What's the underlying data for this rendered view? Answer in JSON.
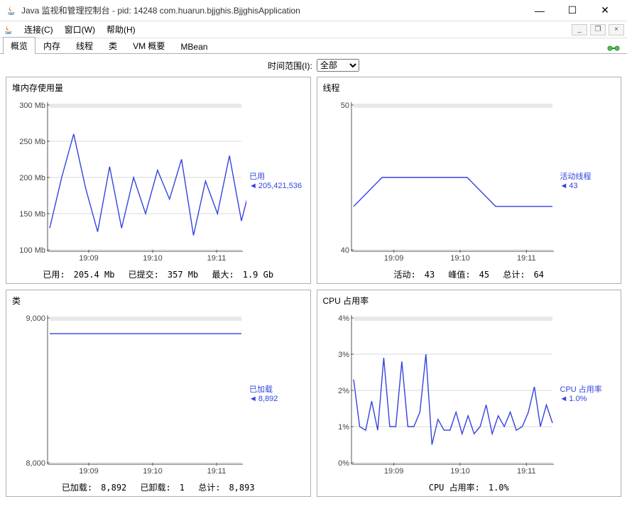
{
  "window": {
    "title": "Java 监视和管理控制台 - pid: 14248 com.huarun.bjjghis.BjjghisApplication"
  },
  "menu": {
    "connect": "连接(C)",
    "window": "窗口(W)",
    "help": "帮助(H)"
  },
  "tabs": [
    "概览",
    "内存",
    "线程",
    "类",
    "VM 概要",
    "MBean"
  ],
  "range": {
    "label": "时间范围(I):",
    "value": "全部"
  },
  "heap": {
    "title": "堆内存使用量",
    "ylabels": [
      "300 Mb",
      "250 Mb",
      "200 Mb",
      "150 Mb",
      "100 Mb"
    ],
    "xlabels": [
      "19:09",
      "19:10",
      "19:11"
    ],
    "legend_title": "已用",
    "legend_value": "205,421,536",
    "stats": {
      "used_l": "已用:",
      "used_v": "205.4  Mb",
      "committed_l": "已提交:",
      "committed_v": "357  Mb",
      "max_l": "最大:",
      "max_v": "1.9  Gb"
    }
  },
  "threads": {
    "title": "线程",
    "ylabels": [
      "50",
      "40"
    ],
    "xlabels": [
      "19:09",
      "19:10",
      "19:11"
    ],
    "legend_title": "活动线程",
    "legend_value": "43",
    "stats": {
      "live_l": "活动:",
      "live_v": "43",
      "peak_l": "峰值:",
      "peak_v": "45",
      "total_l": "总计:",
      "total_v": "64"
    }
  },
  "classes": {
    "title": "类",
    "ylabels": [
      "9,000",
      "8,000"
    ],
    "xlabels": [
      "19:09",
      "19:10",
      "19:11"
    ],
    "legend_title": "已加载",
    "legend_value": "8,892",
    "stats": {
      "loaded_l": "已加载:",
      "loaded_v": "8,892",
      "unloaded_l": "已卸载:",
      "unloaded_v": "1",
      "total_l": "总计:",
      "total_v": "8,893"
    }
  },
  "cpu": {
    "title": "CPU 占用率",
    "ylabels": [
      "4%",
      "3%",
      "2%",
      "1%",
      "0%"
    ],
    "xlabels": [
      "19:09",
      "19:10",
      "19:11"
    ],
    "legend_title": "CPU 占用率",
    "legend_value": "1.0%",
    "stats": {
      "label": "CPU 占用率:",
      "value": "1.0%"
    }
  },
  "chart_data": [
    {
      "type": "line",
      "title": "堆内存使用量",
      "xlabel": "",
      "ylabel": "Mb",
      "ylim": [
        100,
        300
      ],
      "x": [
        "19:08:40",
        "19:08:50",
        "19:09:00",
        "19:09:10",
        "19:09:20",
        "19:09:30",
        "19:09:40",
        "19:09:50",
        "19:10:00",
        "19:10:10",
        "19:10:20",
        "19:10:30",
        "19:10:40",
        "19:10:50",
        "19:11:00",
        "19:11:10",
        "19:11:20"
      ],
      "series": [
        {
          "name": "已用",
          "values": [
            130,
            200,
            260,
            185,
            125,
            215,
            130,
            200,
            150,
            210,
            170,
            225,
            120,
            195,
            150,
            230,
            140,
            205
          ]
        }
      ]
    },
    {
      "type": "line",
      "title": "线程",
      "xlabel": "",
      "ylabel": "",
      "ylim": [
        40,
        50
      ],
      "x": [
        "19:08:40",
        "19:09:00",
        "19:09:30",
        "19:10:00",
        "19:10:15",
        "19:10:30",
        "19:11:00",
        "19:11:25"
      ],
      "series": [
        {
          "name": "活动线程",
          "values": [
            43,
            45,
            45,
            45,
            45,
            43,
            43,
            43
          ]
        }
      ]
    },
    {
      "type": "line",
      "title": "类",
      "xlabel": "",
      "ylabel": "",
      "ylim": [
        8000,
        9000
      ],
      "x": [
        "19:08:40",
        "19:11:25"
      ],
      "series": [
        {
          "name": "已加载",
          "values": [
            8892,
            8892
          ]
        }
      ]
    },
    {
      "type": "line",
      "title": "CPU 占用率",
      "xlabel": "",
      "ylabel": "%",
      "ylim": [
        0,
        4
      ],
      "x": [
        "19:08:40",
        "19:08:45",
        "19:08:50",
        "19:08:55",
        "19:09:00",
        "19:09:05",
        "19:09:10",
        "19:09:15",
        "19:09:20",
        "19:09:25",
        "19:09:30",
        "19:09:35",
        "19:09:40",
        "19:09:45",
        "19:09:50",
        "19:09:55",
        "19:10:00",
        "19:10:05",
        "19:10:10",
        "19:10:15",
        "19:10:20",
        "19:10:25",
        "19:10:30",
        "19:10:35",
        "19:10:40",
        "19:10:45",
        "19:10:50",
        "19:10:55",
        "19:11:00",
        "19:11:05",
        "19:11:10",
        "19:11:15",
        "19:11:20",
        "19:11:25"
      ],
      "series": [
        {
          "name": "CPU 占用率",
          "values": [
            2.3,
            1.0,
            0.9,
            1.7,
            0.9,
            2.9,
            1.0,
            1.0,
            2.8,
            1.0,
            1.0,
            1.4,
            3.0,
            0.5,
            1.2,
            0.9,
            0.9,
            1.4,
            0.8,
            1.3,
            0.8,
            1.0,
            1.6,
            0.8,
            1.3,
            1.0,
            1.4,
            0.9,
            1.0,
            1.4,
            2.1,
            1.0,
            1.6,
            1.1
          ]
        }
      ]
    }
  ]
}
